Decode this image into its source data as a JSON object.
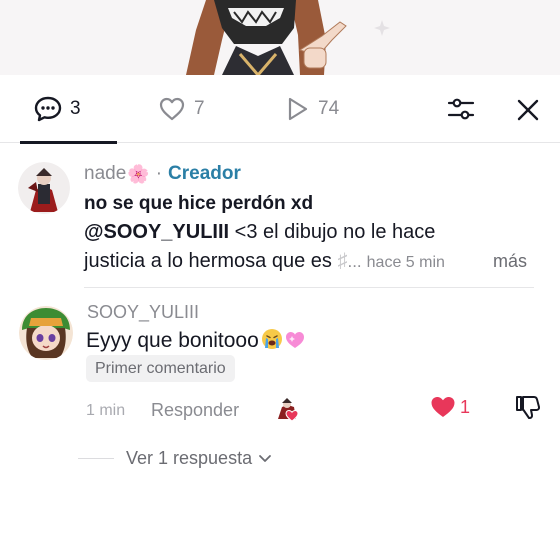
{
  "tabs": {
    "comments": {
      "icon": "comment-bubble-icon",
      "count": "3"
    },
    "likes": {
      "icon": "heart-outline-icon",
      "count": "7"
    },
    "views": {
      "icon": "play-icon",
      "count": "74"
    },
    "filter_icon": "sliders-icon",
    "close_icon": "close-icon"
  },
  "comments": [
    {
      "username": "nade",
      "user_flair": "🌸",
      "separator": "·",
      "role_badge": "Creador",
      "title": "no se que hice perdón xd",
      "mention": "@SOOY_YULIII",
      "text_after_mention": " <3 el dibujo no le hace",
      "line3_text": "justicia a lo hermosa que es ",
      "line3_faded": "♯",
      "ellipsis": "...",
      "time": "hace 5 min",
      "more_label": "más"
    },
    {
      "username": "SOOY_YULIII",
      "text": "Eyyy que bonitooo",
      "badge": "Primer comentario",
      "time": "1 min",
      "reply_label": "Responder",
      "likes": "1",
      "liked_heart_color": "#e8375a",
      "view_replies_label": "Ver 1 respuesta"
    }
  ],
  "colors": {
    "creator_badge": "#2b7fa6",
    "text_primary": "#161823",
    "text_muted": "#8a8b91"
  }
}
